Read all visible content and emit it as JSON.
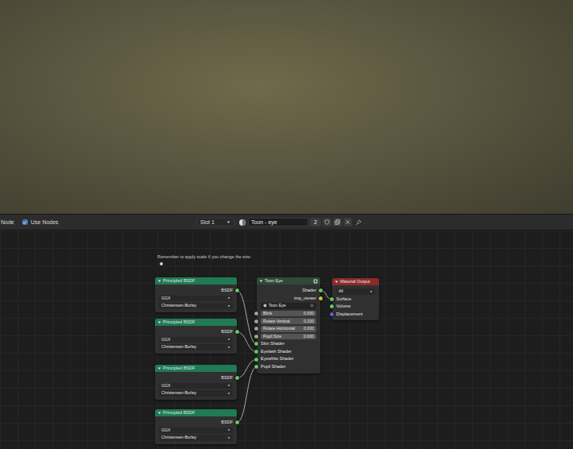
{
  "header": {
    "editor": "Node",
    "use_nodes": {
      "label": "Use Nodes",
      "checked": true
    },
    "slot": "Slot 1",
    "material": "Toon - eye",
    "users": "2"
  },
  "frame_note": "Remember to apply scale if you change the size",
  "nodes": [
    {
      "kind": "principled",
      "title": "Principled BSDF",
      "outputs": [
        {
          "label": "BSDF",
          "color": "#63c763",
          "linked": true
        }
      ],
      "dropdowns": [
        "GGX",
        "Christensen-Burley"
      ]
    },
    {
      "kind": "principled",
      "title": "Principled BSDF",
      "outputs": [
        {
          "label": "BSDF",
          "color": "#63c763",
          "linked": true
        }
      ],
      "dropdowns": [
        "GGX",
        "Christensen-Burley"
      ]
    },
    {
      "kind": "principled",
      "title": "Principled BSDF",
      "outputs": [
        {
          "label": "BSDF",
          "color": "#63c763",
          "linked": true
        }
      ],
      "dropdowns": [
        "GGX",
        "Christensen-Burley"
      ]
    },
    {
      "kind": "principled",
      "title": "Principled BSDF",
      "outputs": [
        {
          "label": "BSDF",
          "color": "#63c763",
          "linked": true
        }
      ],
      "dropdowns": [
        "GGX",
        "Christensen-Burley"
      ]
    },
    {
      "kind": "group",
      "title": "Toon Eye",
      "outputs": [
        {
          "label": "Shader",
          "color": "#63c763",
          "linked": true
        },
        {
          "label": "tmp_viewer",
          "color": "#c7c729",
          "linked": false
        }
      ],
      "datablock": "Toon Eye",
      "fields": [
        {
          "label": "Blink",
          "value": "0.000",
          "color": "#a1a1a1"
        },
        {
          "label": "Rotate Vertical",
          "value": "0.200",
          "color": "#a1a1a1"
        },
        {
          "label": "Rotate Horizontal",
          "value": "0.000",
          "color": "#a1a1a1"
        },
        {
          "label": "Pupil Size",
          "value": "0.600",
          "color": "#a1a1a1"
        }
      ],
      "inputs": [
        {
          "label": "Skin Shader",
          "color": "#63c763",
          "linked": true
        },
        {
          "label": "Eyelash Shader",
          "color": "#63c763",
          "linked": true
        },
        {
          "label": "Eyewhite Shader",
          "color": "#63c763",
          "linked": true
        },
        {
          "label": "Pupil Shader",
          "color": "#63c763",
          "linked": true
        }
      ]
    },
    {
      "kind": "output",
      "title": "Material Output",
      "dropdown": "All",
      "inputs": [
        {
          "label": "Surface",
          "color": "#63c763",
          "linked": true
        },
        {
          "label": "Volume",
          "color": "#63c763",
          "linked": false
        },
        {
          "label": "Displacement",
          "color": "#6363c7",
          "linked": false
        }
      ]
    }
  ]
}
